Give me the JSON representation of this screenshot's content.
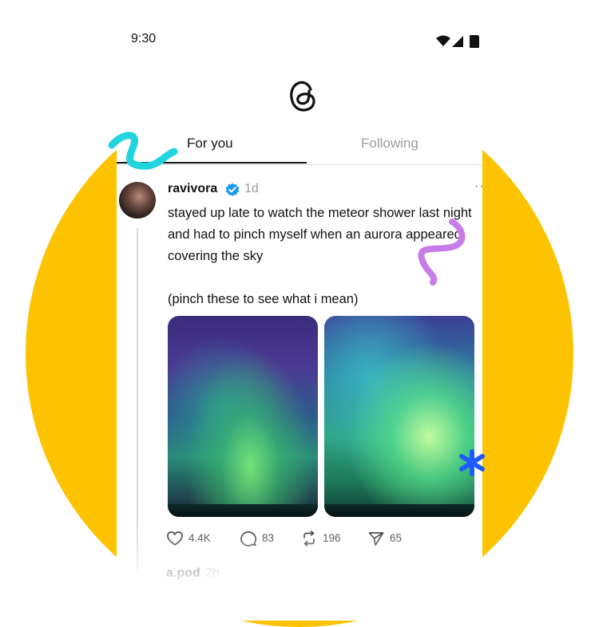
{
  "status_bar": {
    "time": "9:30"
  },
  "app": {
    "logo_icon": "threads-logo-icon"
  },
  "tabs": [
    {
      "label": "For you",
      "active": true
    },
    {
      "label": "Following",
      "active": false
    }
  ],
  "post": {
    "username": "ravivora",
    "verified": true,
    "time": "1d",
    "more": "···",
    "text_lines": [
      "stayed up late to watch the meteor shower last night and had to pinch myself when an aurora appeared, covering the sky",
      "(pinch these to see what i mean)"
    ],
    "images": [
      {
        "alt_icon": "aurora-photo"
      },
      {
        "alt_icon": "aurora-photo"
      }
    ],
    "actions": {
      "likes": "4.4K",
      "replies": "83",
      "reposts": "196",
      "shares": "65"
    }
  },
  "next_post": {
    "username": "a.pod",
    "time": "2h"
  },
  "colors": {
    "background_circle": "#FDC300",
    "verified": "#1D9BF0",
    "squiggle_cyan": "#22D3E0",
    "squiggle_purple": "#C77DE8",
    "sparkle_blue": "#1E5BFF"
  }
}
